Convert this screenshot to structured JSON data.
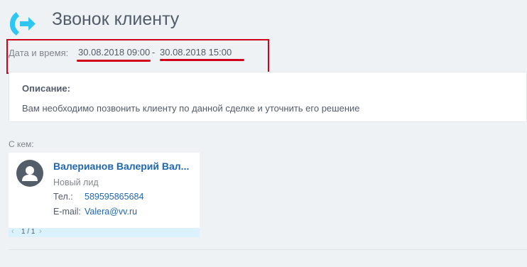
{
  "header": {
    "title": "Звонок клиенту",
    "icon": "call-forward-icon",
    "icon_color": "#2fc6f6"
  },
  "datetime": {
    "label": "Дата и время:",
    "start": "30.08.2018 09:00",
    "separator": "-",
    "end": "30.08.2018 15:00"
  },
  "description": {
    "title": "Описание:",
    "text": "Вам необходимо позвонить клиенту по данной сделке и уточнить его решение"
  },
  "participants": {
    "label": "С кем:",
    "contact": {
      "name": "Валерианов Валерий Вал...",
      "status": "Новый лид",
      "phone_label": "Тел.:",
      "phone": "589595865684",
      "email_label": "E-mail:",
      "email": "Valera@vv.ru"
    },
    "pager": {
      "prev": "‹",
      "text": "1 / 1",
      "next": "›"
    }
  },
  "colors": {
    "highlight": "#d0021b",
    "link": "#2067b0",
    "text": "#535c69"
  }
}
